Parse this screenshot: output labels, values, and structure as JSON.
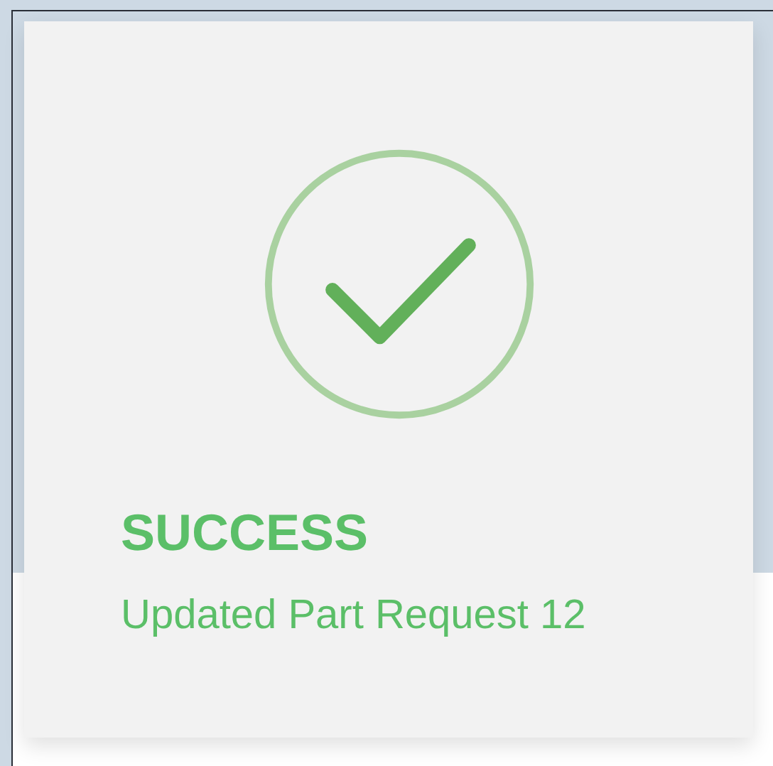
{
  "toast": {
    "kind": "success",
    "title": "SUCCESS",
    "message": "Updated Part Request 12"
  }
}
